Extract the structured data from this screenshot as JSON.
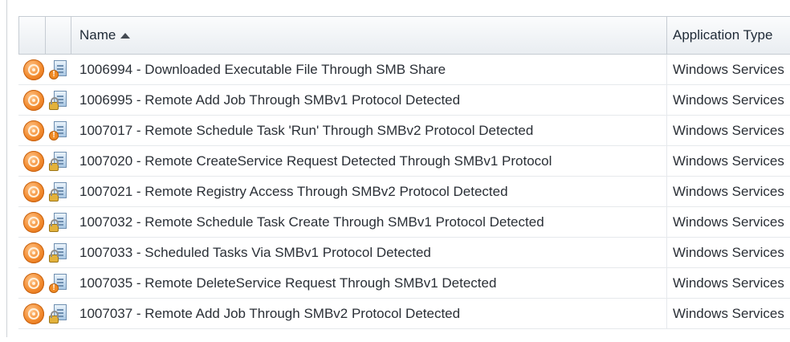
{
  "table": {
    "columns": [
      {
        "label": "",
        "sort": ""
      },
      {
        "label": "",
        "sort": ""
      },
      {
        "label": "Name",
        "sort": "ascending"
      },
      {
        "label": "Application Type",
        "sort": ""
      }
    ],
    "rows": [
      {
        "name": "1006994 - Downloaded Executable File Through SMB Share",
        "application_type": "Windows Services",
        "status_icon": "rule-icon",
        "type_icon": "doc-alert-icon"
      },
      {
        "name": "1006995 - Remote Add Job Through SMBv1 Protocol Detected",
        "application_type": "Windows Services",
        "status_icon": "rule-icon",
        "type_icon": "doc-lock-icon"
      },
      {
        "name": "1007017 - Remote Schedule Task 'Run' Through SMBv2 Protocol Detected",
        "application_type": "Windows Services",
        "status_icon": "rule-icon",
        "type_icon": "doc-alert-icon"
      },
      {
        "name": "1007020 - Remote CreateService Request Detected Through SMBv1 Protocol",
        "application_type": "Windows Services",
        "status_icon": "rule-icon",
        "type_icon": "doc-lock-icon"
      },
      {
        "name": "1007021 - Remote Registry Access Through SMBv2 Protocol Detected",
        "application_type": "Windows Services",
        "status_icon": "rule-icon",
        "type_icon": "doc-lock-icon"
      },
      {
        "name": "1007032 - Remote Schedule Task Create Through SMBv1 Protocol Detected",
        "application_type": "Windows Services",
        "status_icon": "rule-icon",
        "type_icon": "doc-lock-icon"
      },
      {
        "name": "1007033 - Scheduled Tasks Via SMBv1 Protocol Detected",
        "application_type": "Windows Services",
        "status_icon": "rule-icon",
        "type_icon": "doc-lock-icon"
      },
      {
        "name": "1007035 - Remote DeleteService Request Through SMBv1 Detected",
        "application_type": "Windows Services",
        "status_icon": "rule-icon",
        "type_icon": "doc-alert-icon"
      },
      {
        "name": "1007037 - Remote Add Job Through SMBv2 Protocol Detected",
        "application_type": "Windows Services",
        "status_icon": "rule-icon",
        "type_icon": "doc-lock-icon"
      }
    ]
  },
  "colors": {
    "header_bg": "#eef1f4",
    "rule_icon": "#f28a2e",
    "row_border": "#e6e9ec"
  }
}
